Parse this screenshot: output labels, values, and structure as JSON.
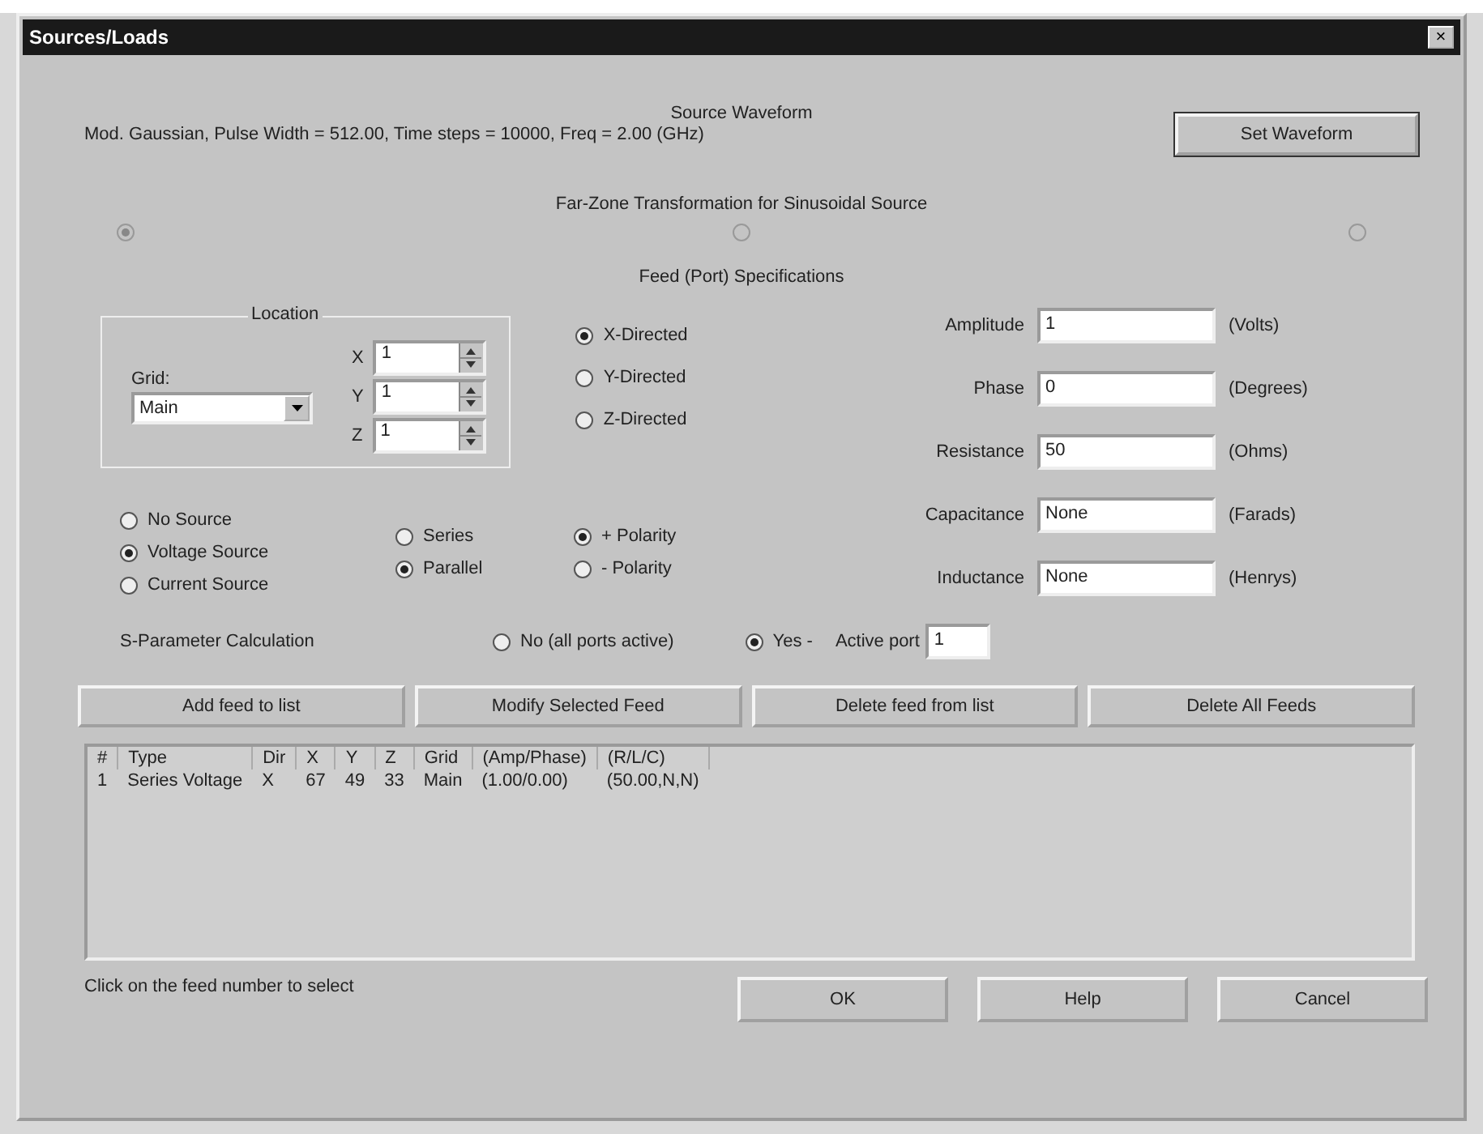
{
  "window": {
    "title": "Sources/Loads",
    "close": "×"
  },
  "waveform": {
    "heading": "Source Waveform",
    "description": "Mod. Gaussian, Pulse Width = 512.00, Time steps = 10000, Freq = 2.00 (GHz)",
    "button": "Set Waveform"
  },
  "far_zone": {
    "heading": "Far-Zone Transformation for Sinusoidal Source",
    "options": [
      {
        "selected": true,
        "disabled": true
      },
      {
        "selected": false,
        "disabled": true
      },
      {
        "selected": false,
        "disabled": true
      }
    ]
  },
  "feed": {
    "heading": "Feed (Port) Specifications",
    "location_label": "Location",
    "grid_label": "Grid:",
    "grid_value": "Main",
    "coords": [
      {
        "axis": "X",
        "value": "1"
      },
      {
        "axis": "Y",
        "value": "1"
      },
      {
        "axis": "Z",
        "value": "1"
      }
    ],
    "directions": [
      {
        "label": "X-Directed",
        "selected": true
      },
      {
        "label": "Y-Directed",
        "selected": false
      },
      {
        "label": "Z-Directed",
        "selected": false
      }
    ],
    "params": [
      {
        "label": "Amplitude",
        "value": "1",
        "unit": "(Volts)"
      },
      {
        "label": "Phase",
        "value": "0",
        "unit": "(Degrees)"
      },
      {
        "label": "Resistance",
        "value": "50",
        "unit": "(Ohms)"
      },
      {
        "label": "Capacitance",
        "value": "None",
        "unit": "(Farads)"
      },
      {
        "label": "Inductance",
        "value": "None",
        "unit": "(Henrys)"
      }
    ],
    "source_types": [
      {
        "label": "No Source",
        "selected": false
      },
      {
        "label": "Voltage Source",
        "selected": true
      },
      {
        "label": "Current Source",
        "selected": false
      }
    ],
    "connection": [
      {
        "label": "Series",
        "selected": false
      },
      {
        "label": "Parallel",
        "selected": true
      }
    ],
    "polarity": [
      {
        "label": "+ Polarity",
        "selected": true
      },
      {
        "label": "- Polarity",
        "selected": false
      }
    ],
    "s_param": {
      "label": "S-Parameter Calculation",
      "options": [
        {
          "label": "No (all ports active)",
          "selected": false
        },
        {
          "label": "Yes -",
          "selected": true
        }
      ],
      "active_port_label": "Active port",
      "active_port_value": "1"
    }
  },
  "actions": [
    "Add feed to list",
    "Modify Selected Feed",
    "Delete feed from list",
    "Delete All Feeds"
  ],
  "table": {
    "columns": [
      "#",
      "Type",
      "Dir",
      "X",
      "Y",
      "Z",
      "Grid",
      "(Amp/Phase)",
      "(R/L/C)"
    ],
    "rows": [
      [
        "1",
        "Series Voltage",
        "X",
        "67",
        "49",
        "33",
        "Main",
        "(1.00/0.00)",
        "(50.00,N,N)"
      ]
    ]
  },
  "hint": "Click on the feed number to select",
  "footer_buttons": [
    "OK",
    "Help",
    "Cancel"
  ]
}
